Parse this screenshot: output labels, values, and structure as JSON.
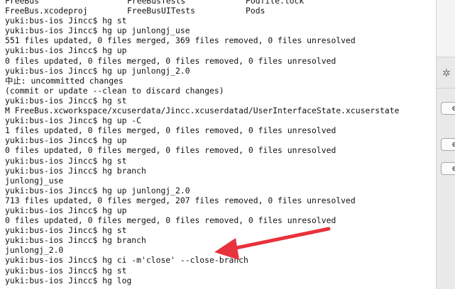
{
  "terminal": {
    "files_row": [
      [
        "FreeBus",
        "FreeBusTests",
        "Podfile.lock"
      ],
      [
        "FreeBus.xcodeproj",
        "FreeBusUITests",
        "Pods"
      ]
    ],
    "lines": [
      "yuki:bus-ios Jincc$ hg st",
      "yuki:bus-ios Jincc$ hg up junlongj_use",
      "551 files updated, 0 files merged, 369 files removed, 0 files unresolved",
      "yuki:bus-ios Jincc$ hg up",
      "0 files updated, 0 files merged, 0 files removed, 0 files unresolved",
      "yuki:bus-ios Jincc$ hg up junlongj_2.0",
      "中止: uncommitted changes",
      "(commit or update --clean to discard changes)",
      "yuki:bus-ios Jincc$ hg st",
      "M FreeBus.xcworkspace/xcuserdata/Jincc.xcuserdatad/UserInterfaceState.xcuserstate",
      "yuki:bus-ios Jincc$ hg up -C",
      "1 files updated, 0 files merged, 0 files removed, 0 files unresolved",
      "yuki:bus-ios Jincc$ hg up",
      "0 files updated, 0 files merged, 0 files removed, 0 files unresolved",
      "yuki:bus-ios Jincc$ hg st",
      "yuki:bus-ios Jincc$ hg branch",
      "junlongj_use",
      "yuki:bus-ios Jincc$ hg up junlongj_2.0",
      "713 files updated, 0 files merged, 207 files removed, 0 files unresolved",
      "yuki:bus-ios Jincc$ hg up",
      "0 files updated, 0 files merged, 0 files removed, 0 files unresolved",
      "yuki:bus-ios Jincc$ hg st",
      "yuki:bus-ios Jincc$ hg branch",
      "junlongj_2.0",
      "yuki:bus-ios Jincc$ hg ci -m'close' --close-branch",
      "yuki:bus-ios Jincc$ hg st",
      "yuki:bus-ios Jincc$ hg log"
    ]
  },
  "side_panel": {
    "gear_icon": "gear-icon",
    "buttons": [
      "e",
      "e",
      "e"
    ]
  },
  "annotation": {
    "arrow_color": "#e8323c"
  }
}
